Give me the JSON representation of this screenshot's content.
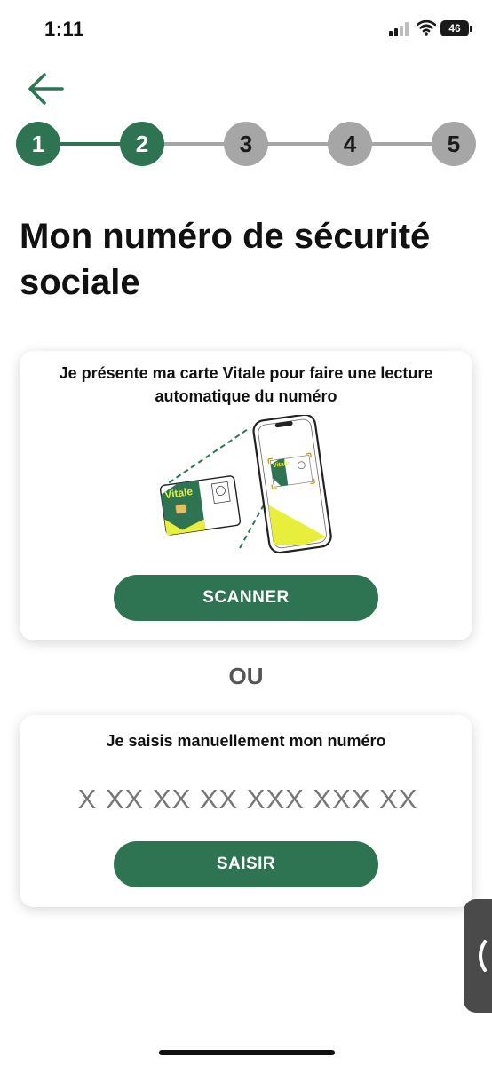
{
  "status_bar": {
    "time": "1:11",
    "battery": "46",
    "icons": [
      "signal-icon",
      "wifi-icon",
      "battery-icon"
    ]
  },
  "navigation": {
    "back_icon": "arrow-left-icon"
  },
  "stepper": {
    "current_step": 2,
    "steps": [
      {
        "label": "1",
        "state": "done"
      },
      {
        "label": "2",
        "state": "done"
      },
      {
        "label": "3",
        "state": "todo"
      },
      {
        "label": "4",
        "state": "todo"
      },
      {
        "label": "5",
        "state": "todo"
      }
    ]
  },
  "title": "Mon numéro de sécurité sociale",
  "scan_card": {
    "description": "Je présente ma carte Vitale pour faire une lecture automatique du numéro",
    "card_label": "Vitale",
    "button_label": "SCANNER"
  },
  "or_label": "OU",
  "manual_card": {
    "description": "Je saisis manuellement mon numéro",
    "input_value": "",
    "input_placeholder": "X XX XX XX XXX XXX XX",
    "button_label": "SAISIR"
  },
  "side_handle": {
    "icon": "chevron-left-icon"
  },
  "colors": {
    "primary": "#2e7452",
    "step_inactive": "#a6a6a6",
    "illustration_yellow": "#e8ee3c",
    "text": "#111111"
  }
}
